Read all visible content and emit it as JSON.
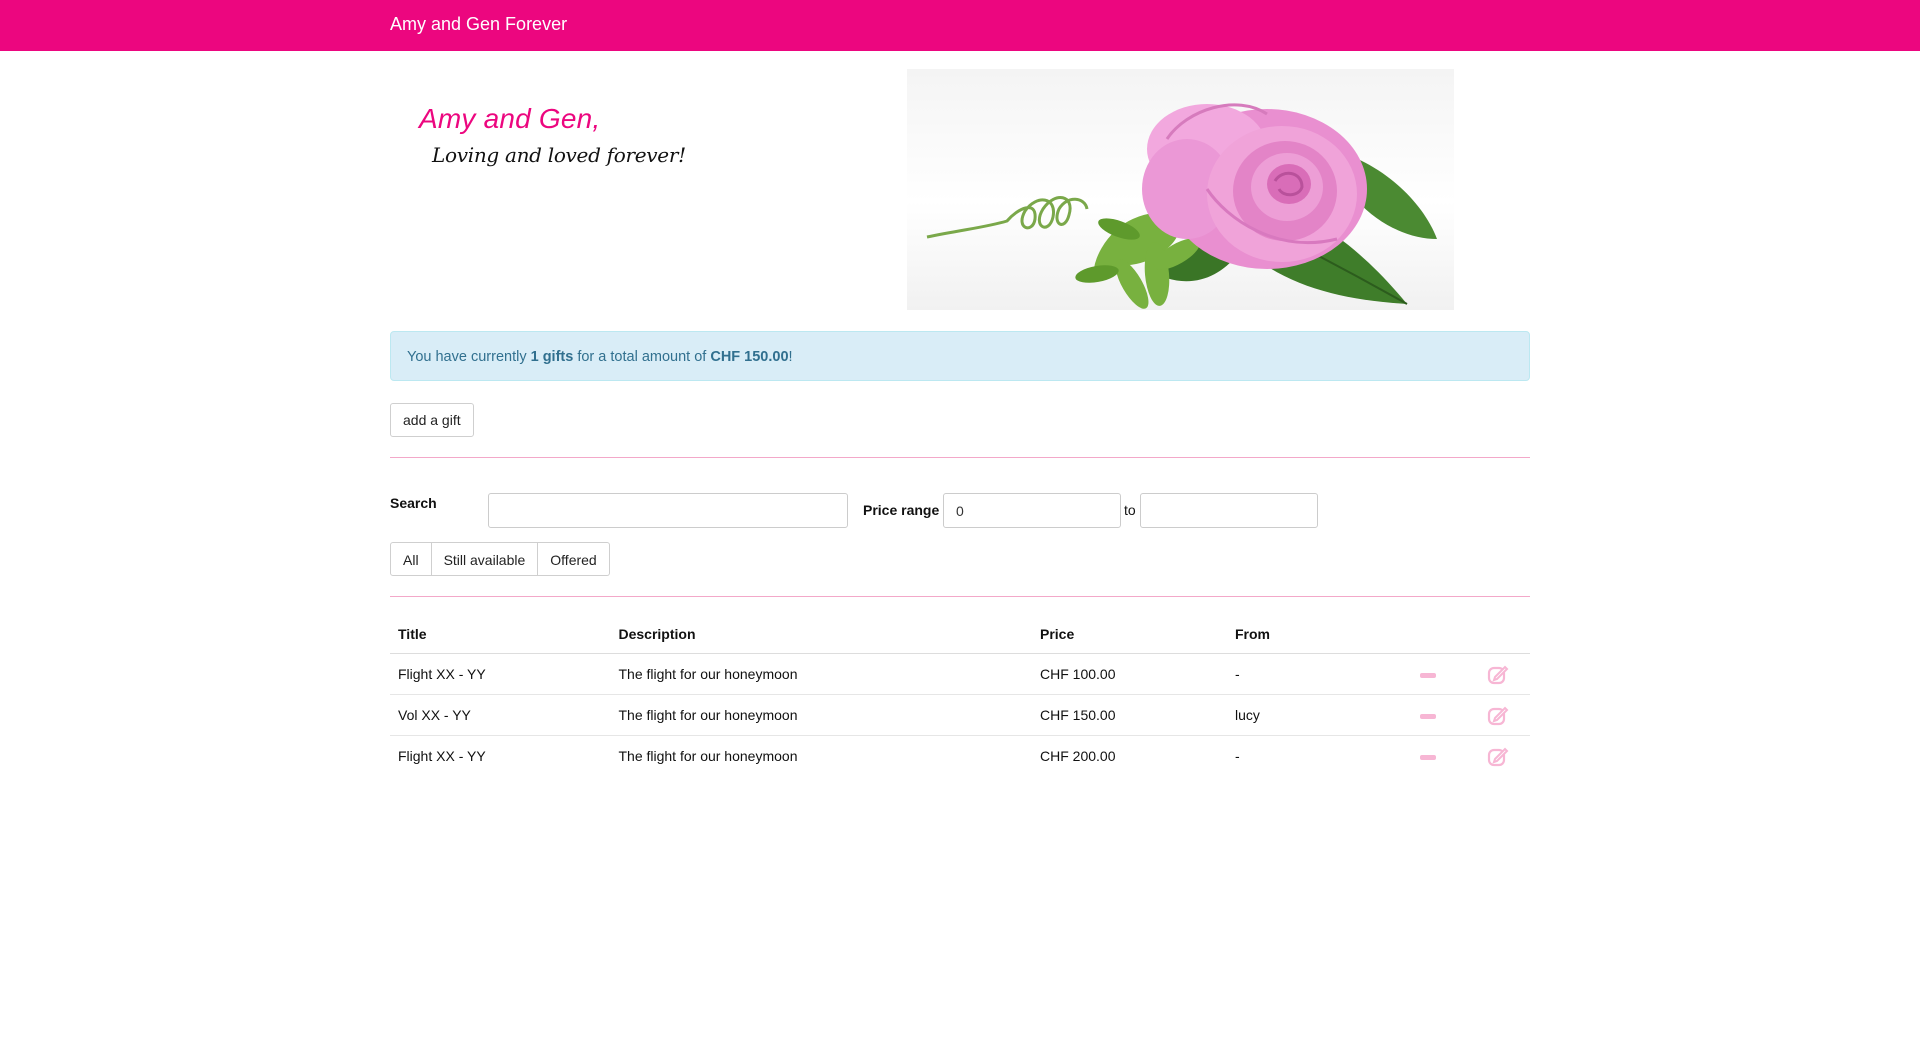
{
  "navbar": {
    "brand": "Amy and Gen Forever"
  },
  "hero": {
    "title": "Amy and Gen,",
    "subtitle": "Loving and loved forever!",
    "image": "pink-rose-photo"
  },
  "alert": {
    "prefix": "You have currently ",
    "gifts_count": "1 gifts",
    "middle": " for a total amount of ",
    "total": "CHF 150.00",
    "suffix": "!"
  },
  "actions": {
    "add_gift_label": "add a gift"
  },
  "filters": {
    "search_label": "Search",
    "search_value": "",
    "price_range_label": "Price range",
    "price_min": "0",
    "price_max": "",
    "to_label": "to",
    "segments": [
      "All",
      "Still available",
      "Offered"
    ]
  },
  "table": {
    "headers": {
      "title": "Title",
      "description": "Description",
      "price": "Price",
      "from": "From"
    },
    "rows": [
      {
        "title": "Flight XX - YY",
        "description": "The flight for our honeymoon",
        "price": "CHF 100.00",
        "from": "-"
      },
      {
        "title": "Vol XX - YY",
        "description": "The flight for our honeymoon",
        "price": "CHF 150.00",
        "from": "lucy"
      },
      {
        "title": "Flight XX - YY",
        "description": "The flight for our honeymoon",
        "price": "CHF 200.00",
        "from": "-"
      }
    ]
  },
  "colors": {
    "brand": "#ec067f",
    "alert_bg": "#d9edf7",
    "alert_text": "#31708f",
    "icon_pink": "#f7b6d4"
  }
}
